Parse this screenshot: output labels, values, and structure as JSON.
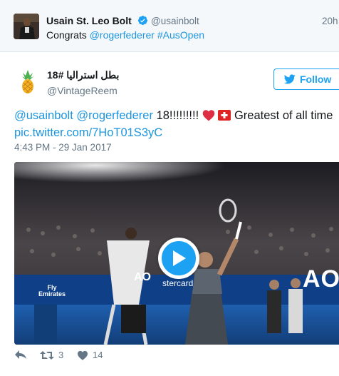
{
  "parent_tweet": {
    "name": "Usain St. Leo Bolt",
    "handle": "@usainbolt",
    "time": "20h",
    "text_prefix": "Congrats ",
    "mention": "@rogerfederer",
    "hashtag": "#AusOpen"
  },
  "main_tweet": {
    "name": "بطل استراليا #18",
    "handle": "@VintageReem",
    "follow_label": "Follow",
    "mention_1": "@usainbolt",
    "mention_2": "@rogerfederer",
    "text_middle": "18!!!!!!!!!",
    "text_end": "Greatest of all time",
    "pic_link": "pic.twitter.com/7HoT01S3yC",
    "timestamp": "4:43 PM - 29 Jan 2017"
  },
  "video": {
    "sponsor_1": "Fly",
    "sponsor_2": "Emirates",
    "ao_logo_large": "AO",
    "ao_logo_small": "AO",
    "ad_fragment": "stercard"
  },
  "actions": {
    "retweet_count": "3",
    "like_count": "14"
  },
  "colors": {
    "link": "#1b95e0",
    "follow_blue": "#1da1f2",
    "heart_red": "#e0245e",
    "muted": "#657786"
  }
}
